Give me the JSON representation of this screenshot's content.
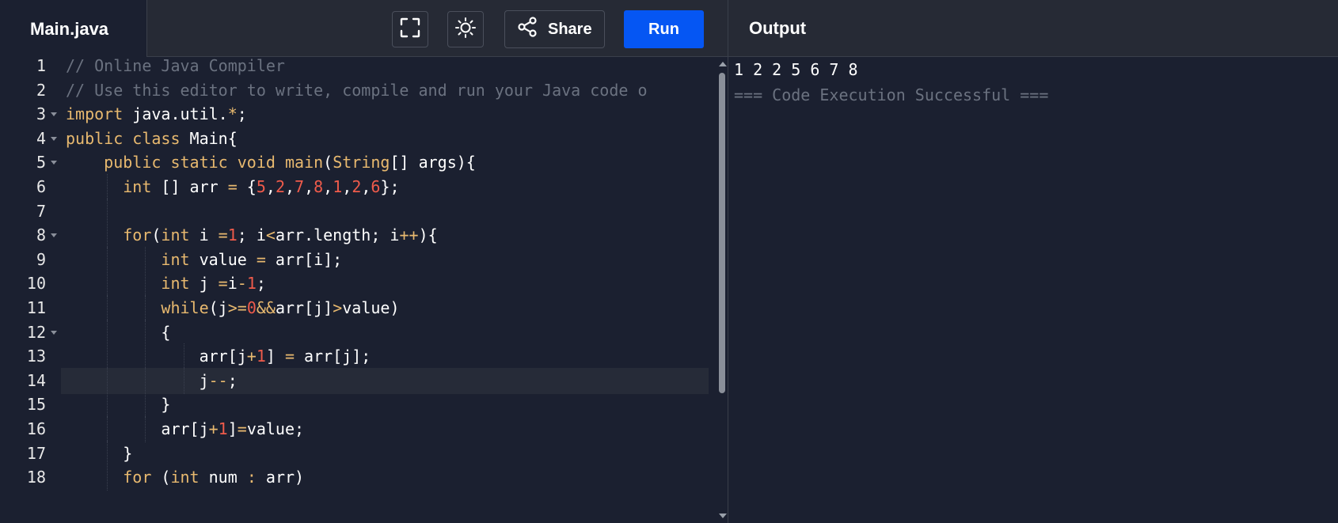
{
  "file_tab": {
    "label": "Main.java"
  },
  "toolbar": {
    "fullscreen_icon": "fullscreen-icon",
    "theme_icon": "sun-icon",
    "share_label": "Share",
    "run_label": "Run"
  },
  "output": {
    "title": "Output",
    "result_line": "1 2 2 5 6 7 8",
    "status_line": "=== Code Execution Successful ==="
  },
  "editor": {
    "active_line": 14,
    "lines": [
      {
        "num": "1",
        "fold": false,
        "indent": 0,
        "tokens": [
          [
            "c",
            "// Online Java Compiler"
          ]
        ]
      },
      {
        "num": "2",
        "fold": false,
        "indent": 0,
        "tokens": [
          [
            "c",
            "// Use this editor to write, compile and run your Java code o"
          ]
        ]
      },
      {
        "num": "3",
        "fold": true,
        "indent": 0,
        "tokens": [
          [
            "k",
            "import"
          ],
          [
            "p",
            " java.util."
          ],
          [
            "o",
            "*"
          ],
          [
            "p",
            ";"
          ]
        ]
      },
      {
        "num": "4",
        "fold": true,
        "indent": 0,
        "tokens": [
          [
            "k",
            "public"
          ],
          [
            "p",
            " "
          ],
          [
            "k",
            "class"
          ],
          [
            "p",
            " Main{"
          ]
        ]
      },
      {
        "num": "5",
        "fold": true,
        "indent": 1,
        "tokens": [
          [
            "p",
            "    "
          ],
          [
            "k",
            "public"
          ],
          [
            "p",
            " "
          ],
          [
            "k",
            "static"
          ],
          [
            "p",
            " "
          ],
          [
            "k",
            "void"
          ],
          [
            "p",
            " "
          ],
          [
            "f",
            "main"
          ],
          [
            "p",
            "("
          ],
          [
            "k",
            "String"
          ],
          [
            "p",
            "[] args){"
          ]
        ]
      },
      {
        "num": "6",
        "fold": false,
        "indent": 2,
        "tokens": [
          [
            "p",
            "      "
          ],
          [
            "k",
            "int"
          ],
          [
            "p",
            " [] arr "
          ],
          [
            "o",
            "="
          ],
          [
            "p",
            " {"
          ],
          [
            "n",
            "5"
          ],
          [
            "p",
            ","
          ],
          [
            "n",
            "2"
          ],
          [
            "p",
            ","
          ],
          [
            "n",
            "7"
          ],
          [
            "p",
            ","
          ],
          [
            "n",
            "8"
          ],
          [
            "p",
            ","
          ],
          [
            "n",
            "1"
          ],
          [
            "p",
            ","
          ],
          [
            "n",
            "2"
          ],
          [
            "p",
            ","
          ],
          [
            "n",
            "6"
          ],
          [
            "p",
            "};"
          ]
        ]
      },
      {
        "num": "7",
        "fold": false,
        "indent": 2,
        "tokens": [
          [
            "p",
            "      "
          ]
        ]
      },
      {
        "num": "8",
        "fold": true,
        "indent": 2,
        "tokens": [
          [
            "p",
            "      "
          ],
          [
            "k",
            "for"
          ],
          [
            "p",
            "("
          ],
          [
            "k",
            "int"
          ],
          [
            "p",
            " i "
          ],
          [
            "o",
            "="
          ],
          [
            "n",
            "1"
          ],
          [
            "p",
            "; i"
          ],
          [
            "o",
            "<"
          ],
          [
            "p",
            "arr.length; i"
          ],
          [
            "o",
            "++"
          ],
          [
            "p",
            "){"
          ]
        ]
      },
      {
        "num": "9",
        "fold": false,
        "indent": 3,
        "tokens": [
          [
            "p",
            "          "
          ],
          [
            "k",
            "int"
          ],
          [
            "p",
            " value "
          ],
          [
            "o",
            "="
          ],
          [
            "p",
            " arr[i];"
          ]
        ]
      },
      {
        "num": "10",
        "fold": false,
        "indent": 3,
        "tokens": [
          [
            "p",
            "          "
          ],
          [
            "k",
            "int"
          ],
          [
            "p",
            " j "
          ],
          [
            "o",
            "="
          ],
          [
            "p",
            "i"
          ],
          [
            "o",
            "-"
          ],
          [
            "n",
            "1"
          ],
          [
            "p",
            ";"
          ]
        ]
      },
      {
        "num": "11",
        "fold": false,
        "indent": 3,
        "tokens": [
          [
            "p",
            "          "
          ],
          [
            "k",
            "while"
          ],
          [
            "p",
            "(j"
          ],
          [
            "o",
            ">="
          ],
          [
            "n",
            "0"
          ],
          [
            "o",
            "&&"
          ],
          [
            "p",
            "arr[j]"
          ],
          [
            "o",
            ">"
          ],
          [
            "p",
            "value)"
          ]
        ]
      },
      {
        "num": "12",
        "fold": true,
        "indent": 3,
        "tokens": [
          [
            "p",
            "          {"
          ]
        ]
      },
      {
        "num": "13",
        "fold": false,
        "indent": 4,
        "tokens": [
          [
            "p",
            "              arr[j"
          ],
          [
            "o",
            "+"
          ],
          [
            "n",
            "1"
          ],
          [
            "p",
            "] "
          ],
          [
            "o",
            "="
          ],
          [
            "p",
            " arr[j];"
          ]
        ]
      },
      {
        "num": "14",
        "fold": false,
        "indent": 4,
        "tokens": [
          [
            "p",
            "              j"
          ],
          [
            "o",
            "--"
          ],
          [
            "p",
            ";"
          ]
        ]
      },
      {
        "num": "15",
        "fold": false,
        "indent": 3,
        "tokens": [
          [
            "p",
            "          }"
          ]
        ]
      },
      {
        "num": "16",
        "fold": false,
        "indent": 3,
        "tokens": [
          [
            "p",
            "          arr[j"
          ],
          [
            "o",
            "+"
          ],
          [
            "n",
            "1"
          ],
          [
            "p",
            "]"
          ],
          [
            "o",
            "="
          ],
          [
            "p",
            "value;"
          ]
        ]
      },
      {
        "num": "17",
        "fold": false,
        "indent": 2,
        "tokens": [
          [
            "p",
            "      }"
          ]
        ]
      },
      {
        "num": "18",
        "fold": false,
        "indent": 2,
        "tokens": [
          [
            "p",
            "      "
          ],
          [
            "k",
            "for"
          ],
          [
            "p",
            " ("
          ],
          [
            "k",
            "int"
          ],
          [
            "p",
            " num "
          ],
          [
            "o",
            ":"
          ],
          [
            "p",
            " arr)"
          ]
        ]
      }
    ]
  },
  "colors": {
    "background": "#1b2030",
    "topbar": "#262a35",
    "run_button": "#0556f3",
    "keyword": "#e8b96f",
    "number": "#ef5b4b",
    "comment": "#6b7280"
  }
}
